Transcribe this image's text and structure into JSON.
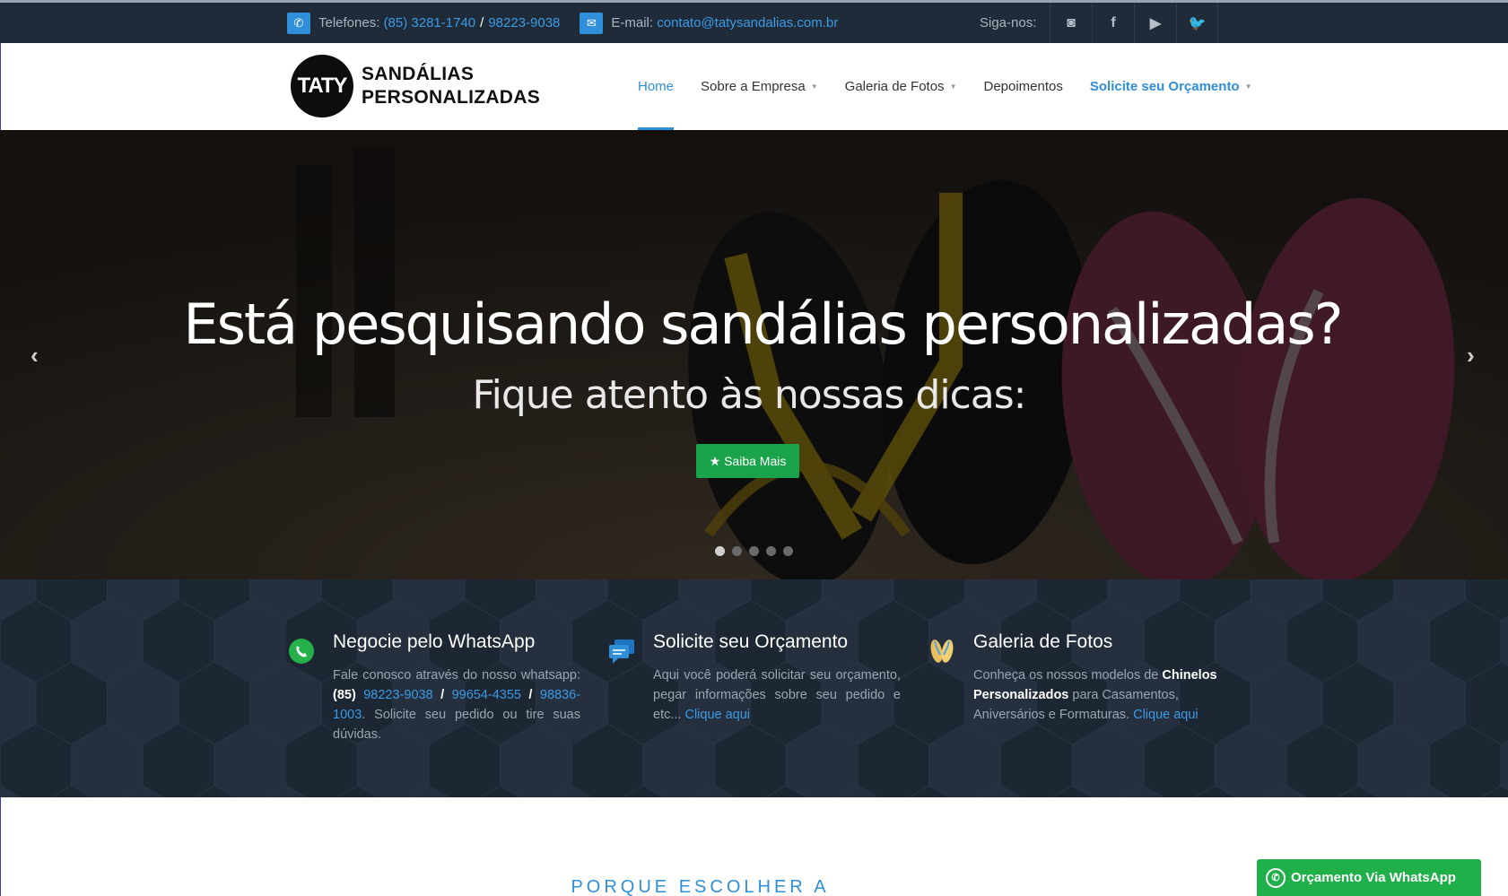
{
  "topbar": {
    "phone_label": "Telefones:",
    "phone1": "(85) 3281-1740",
    "phone_sep": "/",
    "phone2": "98223-9038",
    "email_label": "E-mail:",
    "email": "contato@tatysandalias.com.br",
    "follow_label": "Siga-nos:",
    "social": [
      "instagram-icon",
      "facebook-icon",
      "youtube-icon",
      "twitter-icon"
    ],
    "social_glyphs": [
      "◙",
      "f",
      "▶",
      "🐦"
    ]
  },
  "logo": {
    "circle_text": "TATY",
    "line1": "SANDÁLIAS",
    "line2": "PERSONALIZADAS"
  },
  "nav": {
    "home": "Home",
    "about": "Sobre a Empresa",
    "gallery": "Galeria de Fotos",
    "testimonials": "Depoimentos",
    "quote": "Solicite seu Orçamento"
  },
  "hero": {
    "title": "Está pesquisando sandálias personalizadas?",
    "subtitle": "Fique atento às nossas dicas:",
    "button": "Saiba Mais",
    "button_icon": "★",
    "prev": "‹",
    "next": "›",
    "slide_count": 5,
    "active_slide": 1
  },
  "features": [
    {
      "icon": "whatsapp-icon",
      "title": "Negocie pelo WhatsApp",
      "text_pre": "Fale conosco através do nosso whatsapp: ",
      "area": "(85)",
      "num1": "98223-9038",
      "num2": "99654-4355",
      "num3": "98836-1003",
      "sep": "/",
      "text_post": ". Solicite seu pedido ou tire suas dúvidas."
    },
    {
      "icon": "chat-icon",
      "title": "Solicite seu Orçamento",
      "text": "Aqui você poderá solicitar seu orçamento, pegar informações sobre seu pedido e etc... ",
      "link": "Clique aqui"
    },
    {
      "icon": "sandals-icon",
      "title": "Galeria de Fotos",
      "text_pre": "Conheça os nossos modelos de ",
      "bold": "Chinelos Personalizados",
      "text_post": " para Casamentos, Aniversários e Formaturas. ",
      "link": "Clique aqui"
    }
  ],
  "section_title": "PORQUE ESCOLHER A",
  "whatsapp_float": "Orçamento Via WhatsApp",
  "colors": {
    "accent": "#2f8fd9",
    "topbar_bg": "#1f2b38",
    "features_bg": "#222c3a",
    "green": "#1aa34a"
  }
}
